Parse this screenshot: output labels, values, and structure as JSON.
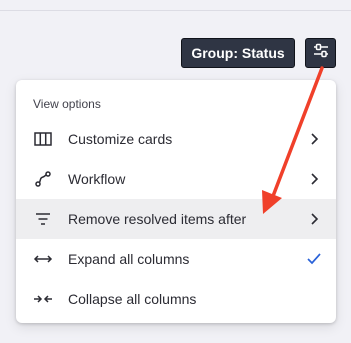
{
  "toolbar": {
    "group_label": "Group: Status",
    "view_options_icon": "sliders-icon"
  },
  "menu": {
    "heading": "View options",
    "items": [
      {
        "label": "Customize cards",
        "icon": "columns-icon",
        "trail": "chevron-right-icon"
      },
      {
        "label": "Workflow",
        "icon": "workflow-icon",
        "trail": "chevron-right-icon"
      },
      {
        "label": "Remove resolved items after",
        "icon": "filter-lines-icon",
        "trail": "chevron-right-icon",
        "highlighted": true
      },
      {
        "label": "Expand all columns",
        "icon": "expand-arrows-icon",
        "trail": "checkmark-icon",
        "checked": true
      },
      {
        "label": "Collapse all columns",
        "icon": "collapse-arrows-icon"
      }
    ]
  },
  "annotation": {
    "arrow_color": "#f0402a"
  },
  "colors": {
    "button_bg": "#2f3544",
    "accent_check": "#2a62d8",
    "highlight_row": "#eeeef0"
  }
}
